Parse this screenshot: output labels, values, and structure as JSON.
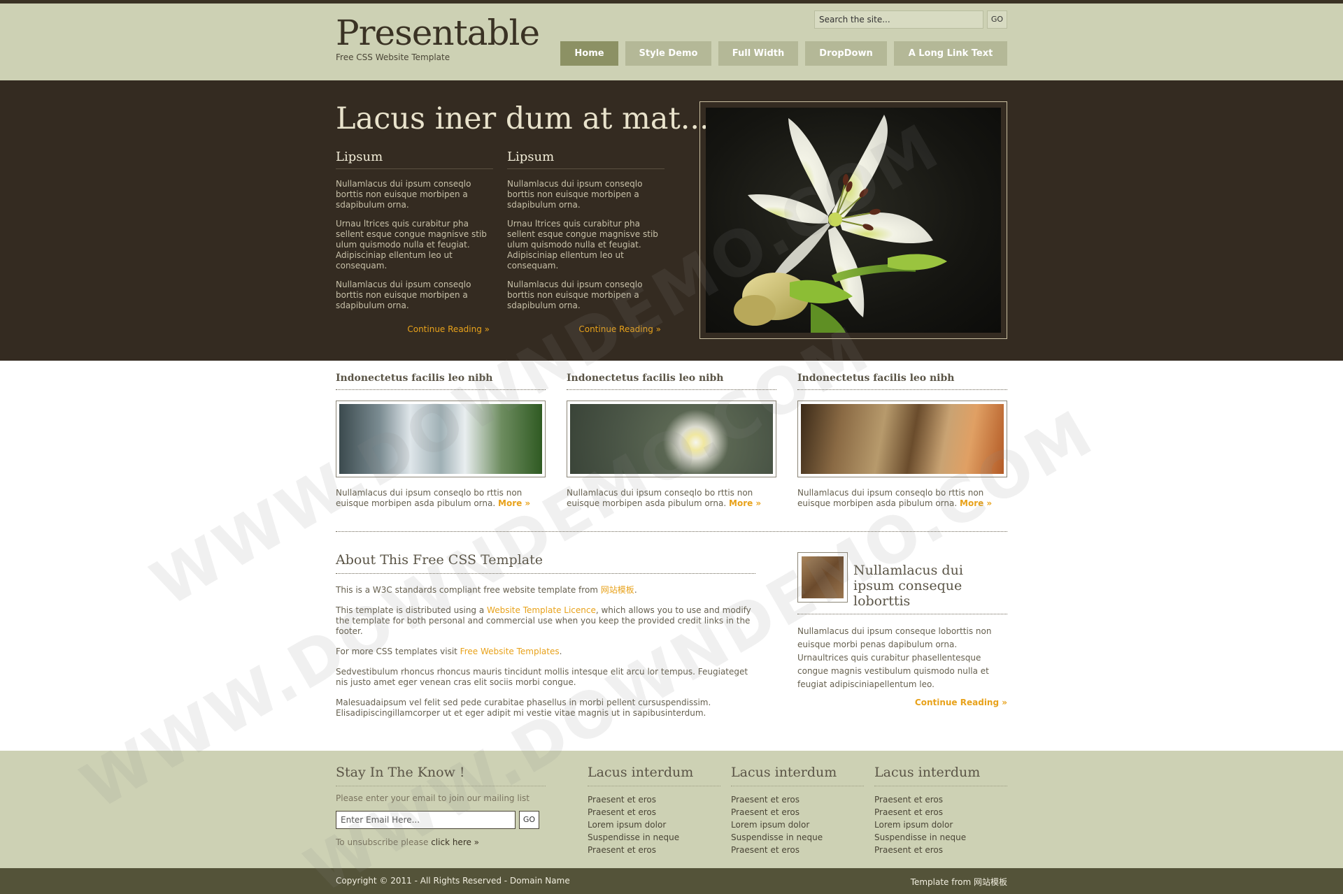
{
  "header": {
    "logo_title": "Presentable",
    "logo_subtitle": "Free CSS Website Template",
    "search_value": "Search the site...",
    "search_button": "GO",
    "nav": [
      {
        "label": "Home",
        "active": true
      },
      {
        "label": "Style Demo",
        "active": false
      },
      {
        "label": "Full Width",
        "active": false
      },
      {
        "label": "DropDown",
        "active": false
      },
      {
        "label": "A Long Link Text",
        "active": false
      }
    ]
  },
  "hero": {
    "title": "Lacus iner dum at mat...",
    "columns": [
      {
        "heading": "Lipsum",
        "paragraphs": [
          "Nullamlacus dui ipsum conseqlo borttis non euisque morbipen a sdapibulum orna.",
          "Urnau ltrices quis curabitur pha sellent esque congue magnisve stib ulum quismodo nulla et feugiat. Adipisciniap ellentum leo ut consequam.",
          "Nullamlacus dui ipsum conseqlo borttis non euisque morbipen a sdapibulum orna."
        ],
        "more": "Continue Reading »"
      },
      {
        "heading": "Lipsum",
        "paragraphs": [
          "Nullamlacus dui ipsum conseqlo borttis non euisque morbipen a sdapibulum orna.",
          "Urnau ltrices quis curabitur pha sellent esque congue magnisve stib ulum quismodo nulla et feugiat. Adipisciniap ellentum leo ut consequam.",
          "Nullamlacus dui ipsum conseqlo borttis non euisque morbipen a sdapibulum orna."
        ],
        "more": "Continue Reading »"
      }
    ]
  },
  "features": [
    {
      "title": "Indonectetus facilis leo nibh",
      "text": "Nullamlacus dui ipsum conseqlo bo rttis non euisque morbipen asda pibulum orna.",
      "more": "More »"
    },
    {
      "title": "Indonectetus facilis leo nibh",
      "text": "Nullamlacus dui ipsum conseqlo bo rttis non euisque morbipen asda pibulum orna.",
      "more": "More »"
    },
    {
      "title": "Indonectetus facilis leo nibh",
      "text": "Nullamlacus dui ipsum conseqlo bo rttis non euisque morbipen asda pibulum orna.",
      "more": "More »"
    }
  ],
  "about": {
    "title": "About This Free CSS Template",
    "p1_pre": "This is a W3C standards compliant free website template from ",
    "p1_link": "网站模板",
    "p1_post": ".",
    "p2_pre": "This template is distributed using a ",
    "p2_link": "Website Template Licence",
    "p2_post": ", which allows you to use and modify the template for both personal and commercial use when you keep the provided credit links in the footer.",
    "p3_pre": "For more CSS templates visit ",
    "p3_link": "Free Website Templates",
    "p3_post": ".",
    "p4": "Sedvestibulum rhoncus rhoncus mauris tincidunt mollis intesque elit arcu lor tempus. Feugiateget nis justo amet eger venean cras elit sociis morbi congue.",
    "p5": "Malesuadaipsum vel felit sed pede curabitae phasellus in morbi pellent cursuspendissim. Elisadipiscingillamcorper ut et eger adipit mi vestie vitae magnis ut in sapibusinterdum."
  },
  "side": {
    "title": "Nullamlacus dui ipsum conseque loborttis",
    "text": "Nullamlacus dui ipsum conseque loborttis non euisque morbi penas dapibulum orna. Urnaultrices quis curabitur phasellentesque congue magnis vestibulum quismodo nulla et feugiat adipisciniapellentum leo.",
    "more": "Continue Reading »"
  },
  "footer": {
    "stay_title": "Stay In The Know !",
    "stay_desc": "Please enter your email to join our mailing list",
    "email_placeholder": "Enter Email Here...",
    "email_button": "GO",
    "unsub_pre": "To unsubscribe please ",
    "unsub_link": "click here »",
    "columns": [
      {
        "title": "Lacus interdum",
        "items": [
          "Praesent et eros",
          "Praesent et eros",
          "Lorem ipsum dolor",
          "Suspendisse in neque",
          "Praesent et eros"
        ]
      },
      {
        "title": "Lacus interdum",
        "items": [
          "Praesent et eros",
          "Praesent et eros",
          "Lorem ipsum dolor",
          "Suspendisse in neque",
          "Praesent et eros"
        ]
      },
      {
        "title": "Lacus interdum",
        "items": [
          "Praesent et eros",
          "Praesent et eros",
          "Lorem ipsum dolor",
          "Suspendisse in neque",
          "Praesent et eros"
        ]
      }
    ],
    "copyright": "Copyright © 2011 - All Rights Reserved - Domain Name",
    "credit": "Template from 网站模板"
  },
  "watermark": "WWW.DOWNDEMO.COM",
  "colors": {
    "header_bg": "#cdd1b4",
    "hero_bg": "#342b21",
    "accent": "#e8a21b",
    "nav_active": "#8c9164",
    "nav_item": "#b4b897",
    "bottom_bar": "#545339"
  }
}
